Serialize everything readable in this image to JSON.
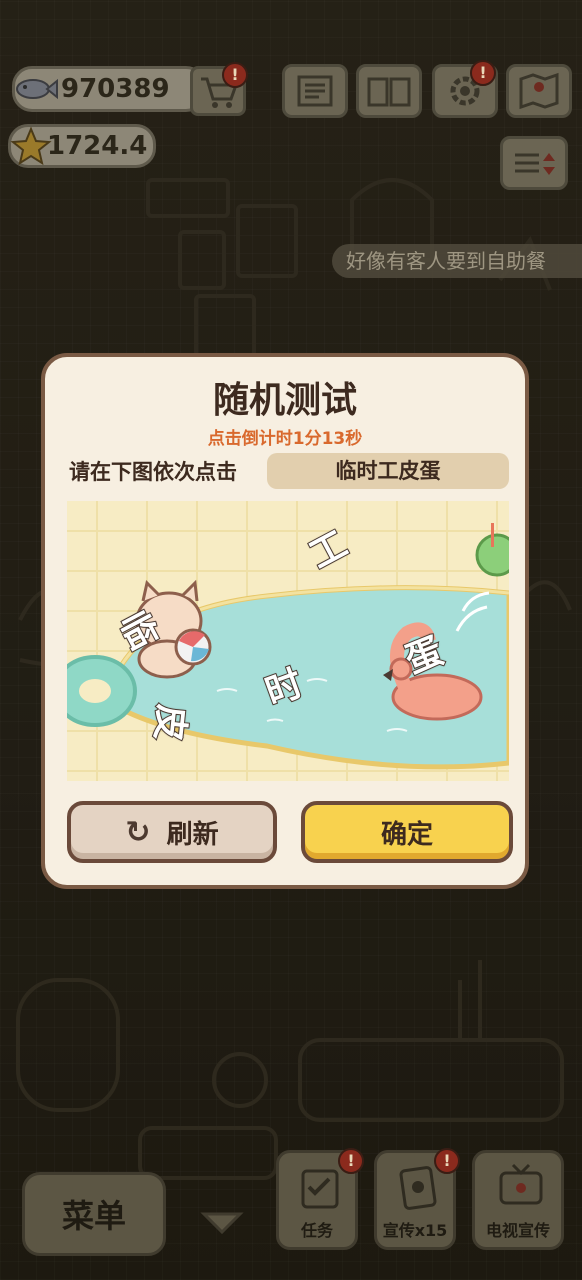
{
  "hud": {
    "fish_count": "970389",
    "star_count": "1724.4"
  },
  "ticker": {
    "text": "好像有客人要到自助餐"
  },
  "dialog": {
    "title": "随机测试",
    "countdown": "点击倒计时1分13秒",
    "prompt": "请在下图依次点击",
    "target_word": "临时工皮蛋",
    "captcha_chars": [
      "工",
      "临",
      "时",
      "皮",
      "蛋"
    ],
    "refresh_label": "刷新",
    "confirm_label": "确定"
  },
  "bottom_bar": {
    "menu_label": "菜单",
    "tasks_label": "任务",
    "promo_label": "宣传x15",
    "tv_label": "电视宣传"
  },
  "colors": {
    "dialog_bg": "#f7efe1",
    "confirm_button": "#f8d24e",
    "countdown_text": "#d9692d"
  }
}
